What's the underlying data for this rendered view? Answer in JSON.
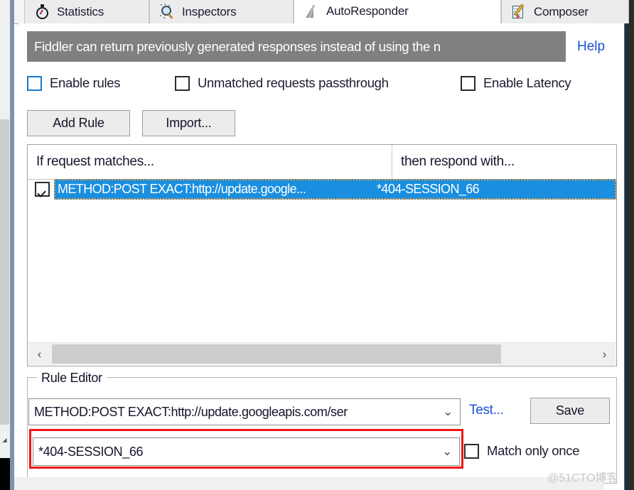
{
  "window": {
    "tabs": [
      {
        "label": "Statistics",
        "icon": "stopwatch-icon",
        "active": false
      },
      {
        "label": "Inspectors",
        "icon": "magnifier-icon",
        "active": false
      },
      {
        "label": "AutoResponder",
        "icon": "lightning-bolt-icon",
        "active": true
      },
      {
        "label": "Composer",
        "icon": "notepad-pencil-icon",
        "active": false
      }
    ]
  },
  "banner": {
    "text": "Fiddler can return previously generated responses instead of using the n",
    "help_label": "Help",
    "background": "#808080",
    "link_color": "#1a4fd6"
  },
  "options": {
    "enable_rules": {
      "label": "Enable rules",
      "checked": false,
      "border": "#1779d0"
    },
    "unmatched_passthrough": {
      "label": "Unmatched requests passthrough",
      "checked": false
    },
    "enable_latency": {
      "label": "Enable Latency",
      "checked": false
    }
  },
  "toolbar": {
    "add_rule_label": "Add Rule",
    "import_label": "Import..."
  },
  "rules_list": {
    "columns": [
      "If request matches...",
      "then respond with..."
    ],
    "rows": [
      {
        "checked": true,
        "match": "METHOD:POST EXACT:http://update.google...",
        "respond": "*404-SESSION_66",
        "selected": true
      }
    ],
    "selection_color": "#1a8fe0",
    "focus_outline_color": "#ff9a2e",
    "scroll": {
      "left_arrow": "‹",
      "right_arrow": "›"
    }
  },
  "rule_editor": {
    "title": "Rule Editor",
    "match_combo": {
      "value": "METHOD:POST EXACT:http://update.googleapis.com/ser",
      "chevron": "⌄"
    },
    "test_label": "Test...",
    "save_label": "Save",
    "response_combo": {
      "value": "*404-SESSION_66",
      "chevron": "⌄"
    },
    "match_only_once": {
      "label": "Match only once",
      "checked": false
    },
    "highlight_color": "#f01616"
  },
  "watermark": {
    "text": "@51CTO博客"
  }
}
